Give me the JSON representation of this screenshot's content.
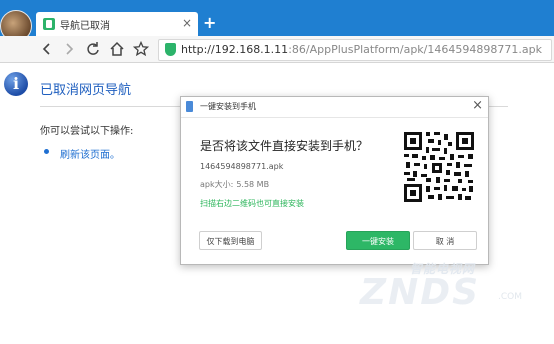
{
  "browser": {
    "tab_title": "导航已取消",
    "tab_close": "×",
    "new_tab": "+",
    "url_host": "http://192.168.1.11",
    "url_rest": ":86/AppPlusPlatform/apk/1464594898771.apk"
  },
  "toolbar": {
    "back_icon": "arrow-left-icon",
    "forward_icon": "arrow-right-icon",
    "reload_icon": "reload-icon",
    "home_icon": "home-icon",
    "bookmark_icon": "star-icon"
  },
  "page": {
    "title": "已取消网页导航",
    "hint": "你可以尝试以下操作:",
    "refresh_link": "刷新该页面。"
  },
  "dialog": {
    "title": "一键安装到手机",
    "close": "×",
    "question": "是否将该文件直接安装到手机？",
    "file_name": "1464594898771.apk",
    "size_label": "apk大小:",
    "size_value": "5.58 MB",
    "qr_hint": "扫描右边二维码也可直接安装",
    "download_button": "仅下载到电脑",
    "install_button": "一键安装",
    "cancel_button": "取 消",
    "accent_color": "#2db766"
  },
  "watermark": {
    "top": "智能电视网",
    "big": "ZNDS",
    "com": ".COM"
  }
}
